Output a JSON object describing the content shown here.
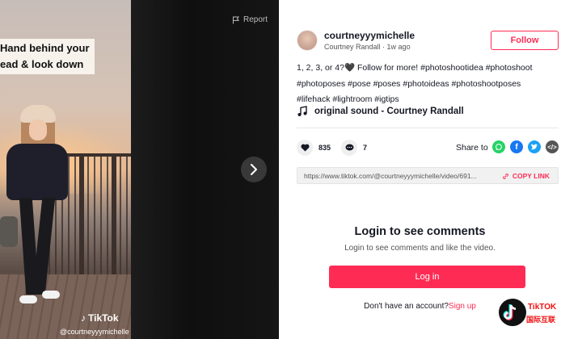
{
  "video": {
    "caption_line1": "Hand behind your",
    "caption_line2": "ead & look down",
    "watermark_logo": "TikTok",
    "watermark_user": "@courtneyyymichelle",
    "report_label": "Report"
  },
  "author": {
    "username": "courtneyyymichelle",
    "display_name": "Courtney Randall",
    "separator": " · ",
    "posted": "1w ago",
    "follow_label": "Follow"
  },
  "post": {
    "description": "1, 2, 3, or 4?🖤 Follow for more! #photoshootidea #photoshoot #photoposes #pose #poses #photoideas #photoshootposes #lifehack #lightroom #igtips",
    "music": "original sound - Courtney Randall"
  },
  "stats": {
    "likes": "835",
    "comments": "7"
  },
  "share": {
    "label": "Share to",
    "icons": [
      "whatsapp-icon",
      "facebook-icon",
      "twitter-icon",
      "embed-icon"
    ],
    "url": "https://www.tiktok.com/@courtneyyymichelle/video/691...",
    "copy_label": "COPY LINK"
  },
  "login": {
    "title": "Login to see comments",
    "subtitle": "Login to see comments and like the video.",
    "button_label": "Log in",
    "no_account": "Don't have an account?",
    "signup_label": "Sign up"
  },
  "brand": {
    "top": "TikTOK",
    "bottom": "国际互联"
  },
  "colors": {
    "accent": "#fe2c55",
    "whatsapp": "#25d366",
    "facebook": "#1877f2",
    "twitter": "#1da1f2",
    "embed": "#555555"
  }
}
